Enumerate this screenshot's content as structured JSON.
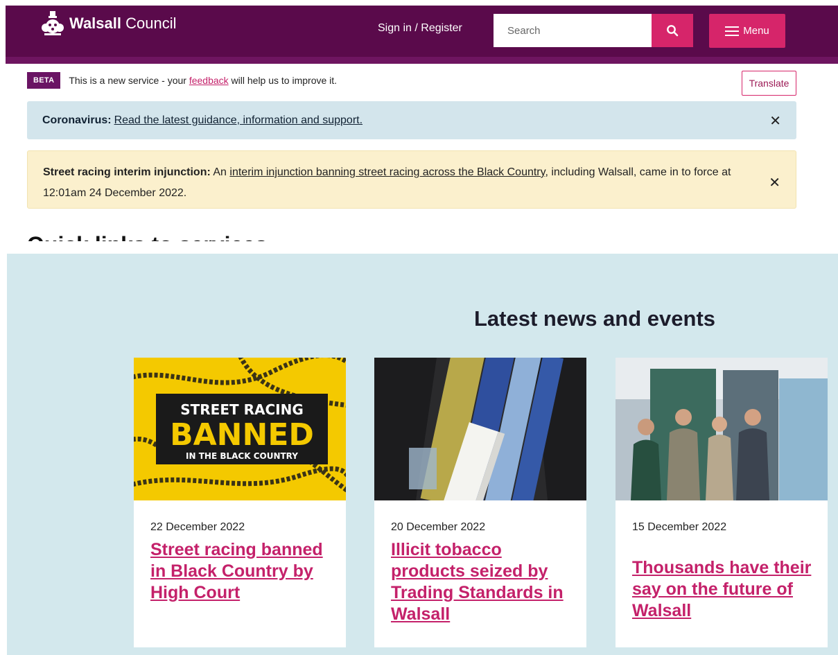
{
  "header": {
    "logo_bold": "Walsall",
    "logo_light": "Council",
    "signin_label": "Sign in / Register",
    "search_placeholder": "Search",
    "menu_label": "Menu",
    "brand_color": "#5a0a4b",
    "accent_color": "#d6256a"
  },
  "beta": {
    "tag": "BETA",
    "text_before": "This is a new service - your",
    "link": "feedback",
    "text_after": "will help us to improve it.",
    "translate_label": "Translate"
  },
  "alerts": {
    "covid": {
      "label": "Coronavirus:",
      "link": "Read the latest guidance, information and support.",
      "close": "✕"
    },
    "street": {
      "label": "Street racing interim injunction:",
      "text_before": "An",
      "link": "interim injunction banning street racing across the Black Country",
      "text_after": ", including Walsall, came in to force at 12:01am 24 December 2022.",
      "close": "✕"
    }
  },
  "partial_heading": "Quick links to services",
  "news": {
    "title": "Latest news and events",
    "items": [
      {
        "date": "22 December 2022",
        "title": "Street racing banned in Black Country by High Court",
        "image_text": {
          "line1": "STREET RACING",
          "line2": "BANNED",
          "line3": "IN THE BLACK COUNTRY"
        }
      },
      {
        "date": "20 December 2022",
        "title": "Illicit tobacco products seized by Trading Standards in Walsall"
      },
      {
        "date": "15 December 2022",
        "title": "Thousands have their say on the future of Walsall"
      }
    ]
  }
}
